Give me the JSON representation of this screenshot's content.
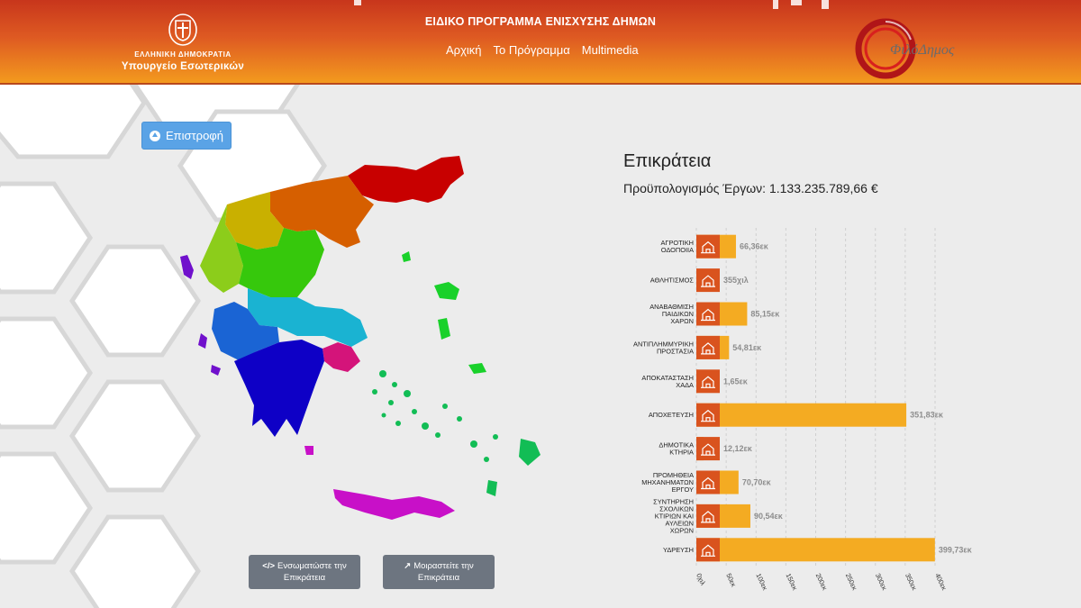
{
  "header": {
    "ministry_line1": "ΕΛΛΗΝΙΚΗ ΔΗΜΟΚΡΑΤΙΑ",
    "ministry_line2": "Υπουργείο Εσωτερικών",
    "program_title": "ΕΙΔΙΚΟ ΠΡΟΓΡΑΜΜΑ ΕΝΙΣΧΥΣΗΣ ΔΗΜΩΝ",
    "nav": [
      "Αρχική",
      "Το Πρόγραμμα",
      "Multimedia"
    ],
    "logo_text": "ΦιλόΔημος"
  },
  "back_button": "Επιστροφή",
  "embed_button": [
    "Ενσωματώστε την",
    "Επικράτεια"
  ],
  "share_button": [
    "Μοιραστείτε την",
    "Επικράτεια"
  ],
  "region": {
    "title": "Επικράτεια",
    "budget_label": "Προϋπολογισμός Έργων:",
    "budget_value": "1.133.235.789,66 €"
  },
  "colors": {
    "bar": "#f4ab22",
    "icon_bg": "#d9531e",
    "header_top": "#c8361c",
    "header_bottom": "#f39a1e",
    "button_blue": "#5aa3e6",
    "button_gray": "#6d7580"
  },
  "chart_data": {
    "type": "bar",
    "orientation": "horizontal",
    "categories": [
      [
        "ΑΓΡΟΤΙΚΗ",
        "ΟΔΟΠΟΙΙΑ"
      ],
      [
        "ΑΘΛΗΤΙΣΜΟΣ"
      ],
      [
        "ΑΝΑΒΑΘΜΙΣΗ",
        "ΠΑΙΔΙΚΩΝ",
        "ΧΑΡΩΝ"
      ],
      [
        "ΑΝΤΙΠΛΗΜΜΥΡΙΚΗ",
        "ΠΡΟΣΤΑΣΙΑ"
      ],
      [
        "ΑΠΟΚΑΤΑΣΤΑΣΗ",
        "ΧΑΔΑ"
      ],
      [
        "ΑΠΟΧΕΤΕΥΣΗ"
      ],
      [
        "ΔΗΜΟΤΙΚΑ",
        "ΚΤΗΡΙΑ"
      ],
      [
        "ΠΡΟΜΗΘΕΙΑ",
        "ΜΗΧΑΝΗΜΑΤΩΝ",
        "ΕΡΓΟΥ"
      ],
      [
        "ΣΥΝΤΗΡΗΣΗ",
        "ΣΧΟΛΙΚΩΝ",
        "ΚΤΙΡΙΩΝ ΚΑΙ",
        "ΑΥΛΕΙΩΝ",
        "ΧΩΡΩΝ"
      ],
      [
        "ΥΔΡΕΥΣΗ"
      ]
    ],
    "values": [
      66.36,
      0.355,
      85.15,
      54.81,
      1.65,
      351.83,
      12.12,
      70.7,
      90.54,
      399.73
    ],
    "value_labels": [
      "66,36εκ",
      "355χιλ",
      "85,15εκ",
      "54,81εκ",
      "1,65εκ",
      "351,83εκ",
      "12,12εκ",
      "70,70εκ",
      "90,54εκ",
      "399,73εκ"
    ],
    "xlim": [
      0,
      400
    ],
    "ticks": [
      0,
      50,
      100,
      150,
      200,
      250,
      300,
      350,
      400
    ],
    "tick_labels": [
      "0χιλ",
      "50εκ",
      "100εκ",
      "150εκ",
      "200εκ",
      "250εκ",
      "300εκ",
      "350εκ",
      "400εκ"
    ],
    "grid": "vertical dashed",
    "legend": "none"
  }
}
